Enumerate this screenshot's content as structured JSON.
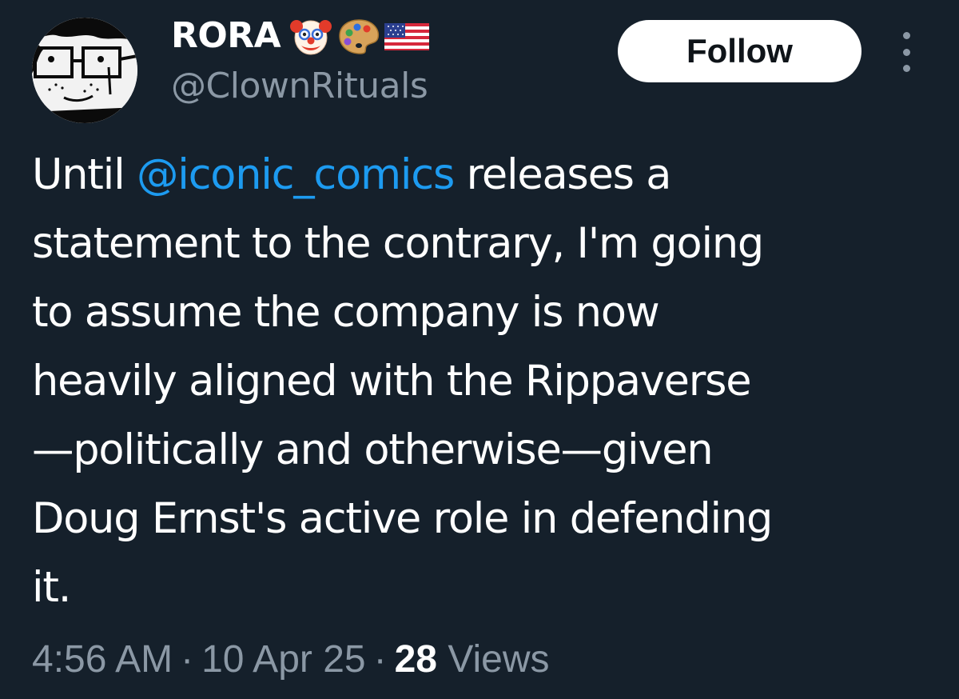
{
  "author": {
    "display_name": "RORA",
    "handle": "@ClownRituals",
    "badges": [
      "clown-face-icon",
      "artist-palette-icon",
      "us-flag-icon"
    ]
  },
  "actions": {
    "follow_label": "Follow",
    "more_icon": "more-vertical-icon"
  },
  "tweet": {
    "lines": [
      {
        "pre": "Until ",
        "mention": "@iconic_comics",
        "post": " releases a"
      },
      "statement to the contrary, I'm going",
      "to assume the company is now",
      "heavily aligned with the Rippaverse",
      "—politically and otherwise—given",
      "Doug Ernst's active role in defending",
      "it."
    ]
  },
  "meta": {
    "time": "4:56 AM",
    "date": "10 Apr 25",
    "separator": "·",
    "views_count": "28",
    "views_label": "Views"
  },
  "colors": {
    "background": "#15202b",
    "text_primary": "#ffffff",
    "text_secondary": "#8b98a5",
    "link": "#1d9bf0",
    "follow_bg": "#ffffff",
    "follow_text": "#0f1419"
  }
}
